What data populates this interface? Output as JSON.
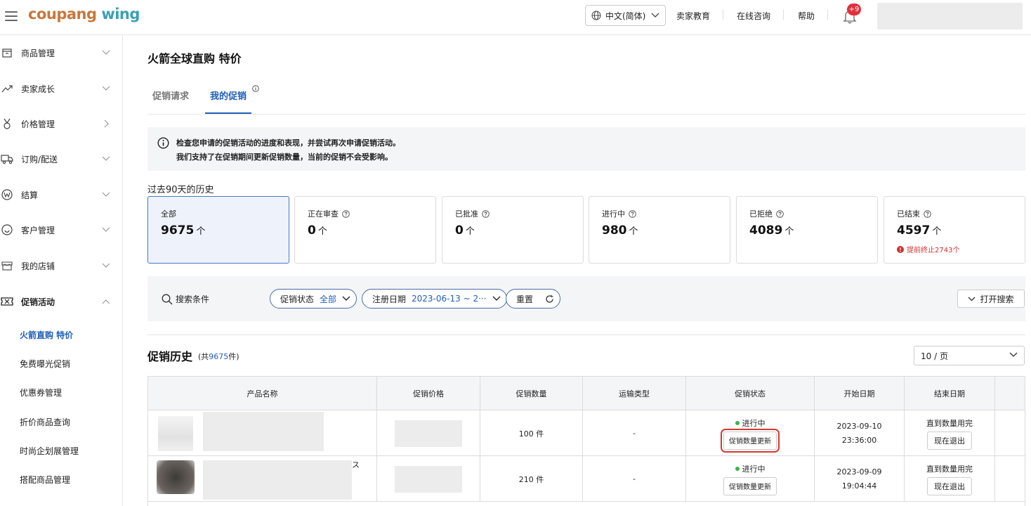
{
  "header": {
    "logo_part1": "coupang",
    "logo_part2": "wing",
    "language": "中文(简体)",
    "links": [
      "卖家教育",
      "在线咨询",
      "帮助"
    ],
    "notification_badge": "+9"
  },
  "sidebar": {
    "items": [
      {
        "label": "商品管理",
        "icon": "box-icon"
      },
      {
        "label": "卖家成长",
        "icon": "trend-icon"
      },
      {
        "label": "价格管理",
        "icon": "medal-icon"
      },
      {
        "label": "订购/配送",
        "icon": "truck-icon"
      },
      {
        "label": "结算",
        "icon": "won-coin-icon"
      },
      {
        "label": "客户管理",
        "icon": "smile-icon"
      },
      {
        "label": "我的店铺",
        "icon": "store-icon"
      },
      {
        "label": "促销活动",
        "icon": "ticket-icon"
      }
    ],
    "subitems": [
      "火箭直购 特价",
      "免费曝光促销",
      "优惠券管理",
      "折价商品查询",
      "时尚企划展管理",
      "搭配商品管理"
    ]
  },
  "page": {
    "title": "火箭全球直购 特价",
    "tabs": [
      "促销请求",
      "我的促销"
    ],
    "notice_line1": "检查您申请的促销活动的进度和表现，并尝试再次申请促销活动。",
    "notice_line2": "我们支持了在促销期间更新促销数量，当前的促销不会受影响。",
    "history_label": "过去90天的历史"
  },
  "stats": [
    {
      "label": "全部",
      "value": "9675",
      "unit": "个"
    },
    {
      "label": "正在审查",
      "value": "0",
      "unit": "个"
    },
    {
      "label": "已批准",
      "value": "0",
      "unit": "个"
    },
    {
      "label": "进行中",
      "value": "980",
      "unit": "个"
    },
    {
      "label": "已拒绝",
      "value": "4089",
      "unit": "个"
    },
    {
      "label": "已结束",
      "value": "4597",
      "unit": "个",
      "warning": "提前终止2743个"
    }
  ],
  "search": {
    "label": "搜索条件",
    "status_label": "促销状态",
    "status_value": "全部",
    "date_label": "注册日期",
    "date_value": "2023-06-13 ~ 2···",
    "reset": "重置",
    "open_search": "打开搜索"
  },
  "history": {
    "title": "促销历史",
    "count_prefix": "(共",
    "count": "9675",
    "count_suffix": "件)",
    "page_size": "10 / 页"
  },
  "table": {
    "columns": [
      "产品名称",
      "促销价格",
      "促销数量",
      "运输类型",
      "促销状态",
      "开始日期",
      "结束日期"
    ],
    "rows": [
      {
        "quantity": "100 件",
        "shipping": "-",
        "status": "进行中",
        "update_btn": "促销数量更新",
        "start_date": "2023-09-10",
        "start_time": "23:36:00",
        "end": "直到数量用完",
        "exit_btn": "现在退出"
      },
      {
        "quantity": "210 件",
        "shipping": "-",
        "status": "进行中",
        "update_btn": "促销数量更新",
        "start_date": "2023-09-09",
        "start_time": "19:04:44",
        "end": "直到数量用完",
        "exit_btn": "现在退出",
        "name_fragment": "ス"
      }
    ]
  },
  "colors": {
    "accent": "#1f5fb8",
    "active_dot": "#3bb34a",
    "badge": "#e2303a",
    "warning": "#d03030"
  }
}
